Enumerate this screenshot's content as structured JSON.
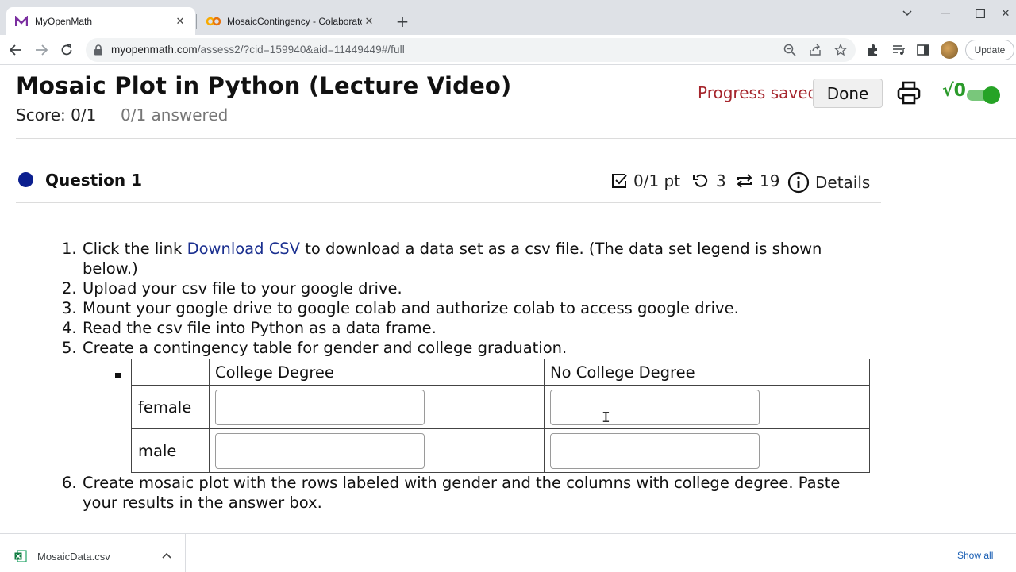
{
  "browser": {
    "tabs": [
      {
        "title": "MyOpenMath",
        "active": true
      },
      {
        "title": "MosaicContingency - Colaborato",
        "active": false
      }
    ],
    "url_host": "myopenmath.com",
    "url_path": "/assess2/?cid=159940&aid=11449449#/full",
    "update_label": "Update"
  },
  "header": {
    "title": "Mosaic Plot in Python (Lecture Video)",
    "score": "Score: 0/1",
    "answered": "0/1 answered",
    "progress": "Progress saved",
    "done_label": "Done",
    "sqrt_label": "√0"
  },
  "question": {
    "title": "Question 1",
    "points": "0/1 pt",
    "retries": "3",
    "versions": "19",
    "details_label": "Details"
  },
  "steps": [
    {
      "num": "1.",
      "before": "Click the link ",
      "link": "Download CSV",
      "after": " to download a data set as a csv file. (The data set legend is shown below.)"
    },
    {
      "num": "2.",
      "text": "Upload your csv file to your google drive."
    },
    {
      "num": "3.",
      "text": "Mount your google drive to google colab and authorize colab to access google drive."
    },
    {
      "num": "4.",
      "text": "Read the csv file into Python as a data frame."
    },
    {
      "num": "5.",
      "text": "Create a contingency table for gender and college graduation."
    },
    {
      "num": "6.",
      "text": "Create mosaic plot with the rows labeled with gender and the columns with college degree. Paste your results in the answer box."
    }
  ],
  "table": {
    "columns": [
      "",
      "College Degree",
      "No College Degree"
    ],
    "rows": [
      "female",
      "male"
    ]
  },
  "download_bar": {
    "file": "MosaicData.csv",
    "show_all": "Show all"
  },
  "colors": {
    "progress": "#a6262d",
    "question_dot": "#0b1f8f",
    "toggle": "#26a326",
    "link": "#1a2f8f"
  }
}
